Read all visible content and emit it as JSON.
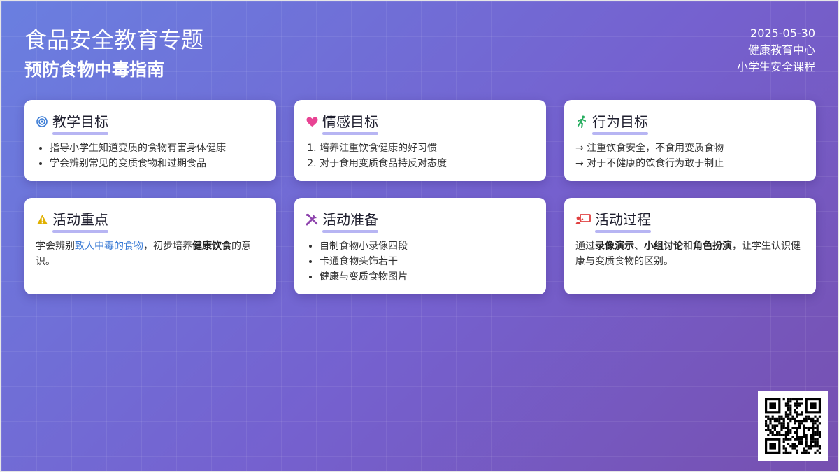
{
  "header": {
    "title": "食品安全教育专题",
    "subtitle": "预防食物中毒指南",
    "date": "2025-05-30",
    "org": "健康教育中心",
    "course": "小学生安全课程"
  },
  "cards": {
    "teaching": {
      "icon": "target-icon",
      "title": "教学目标",
      "items": [
        "指导小学生知道变质的食物有害身体健康",
        "学会辨别常见的变质食物和过期食品"
      ]
    },
    "emotion": {
      "icon": "heart-icon",
      "title": "情感目标",
      "items": [
        "培养注重饮食健康的好习惯",
        "对于食用变质食品持反对态度"
      ]
    },
    "behavior": {
      "icon": "running-person-icon",
      "title": "行为目标",
      "items": [
        "注重饮食安全，不食用变质食物",
        "对于不健康的饮食行为敢于制止"
      ]
    },
    "focus": {
      "icon": "warning-icon",
      "title": "活动重点",
      "text_1": "学会辨别",
      "link": "致人中毒的食物",
      "text_2": "，初步培养",
      "bold": "健康饮食",
      "text_3": "的意识。"
    },
    "prep": {
      "icon": "tools-icon",
      "title": "活动准备",
      "items": [
        "自制食物小录像四段",
        "卡通食物头饰若干",
        "健康与变质食物图片"
      ]
    },
    "process": {
      "icon": "presentation-icon",
      "title": "活动过程",
      "text_1": "通过",
      "bold_1": "录像演示",
      "sep_1": "、",
      "bold_2": "小组讨论",
      "sep_2": "和",
      "bold_3": "角色扮演",
      "text_2": "，让学生认识健康与变质食物的区别。"
    }
  },
  "qr": {
    "icon": "qr-code-icon"
  },
  "colors": {
    "accent_underline": "#b7b5f3",
    "target": "#3a7bd5",
    "heart": "#e84393",
    "run": "#27ae60",
    "warning": "#e0b000",
    "tools": "#8e44ad",
    "presentation": "#e04040",
    "link": "#3a7bd5"
  }
}
